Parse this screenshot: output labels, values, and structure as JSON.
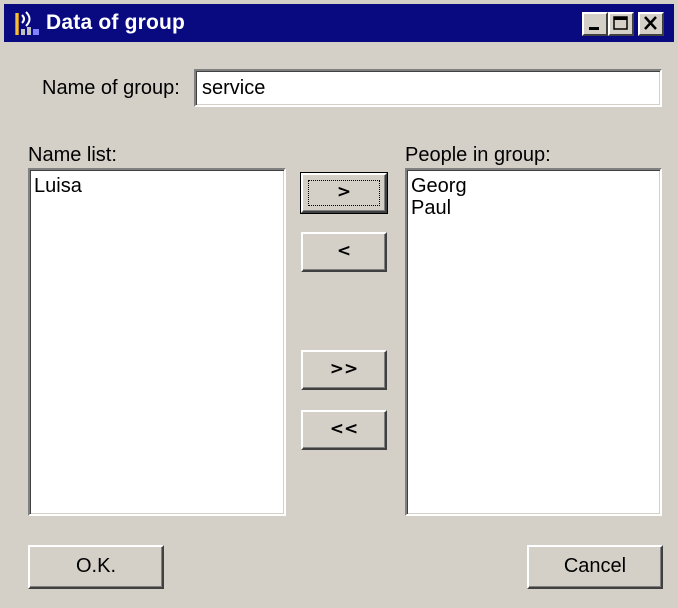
{
  "window": {
    "title": "Data of group",
    "icon": "antenna-app-icon"
  },
  "form": {
    "group_name_label": "Name of group:",
    "group_name_value": "service"
  },
  "name_list": {
    "label": "Name list:",
    "items": [
      "Luisa"
    ]
  },
  "group_list": {
    "label": "People in group:",
    "items": [
      "Georg",
      "Paul"
    ]
  },
  "transfer_buttons": {
    "add_one": ">",
    "remove_one": "<",
    "add_all": ">>",
    "remove_all": "<<"
  },
  "actions": {
    "ok": "O.K.",
    "cancel": "Cancel"
  },
  "colors": {
    "titlebar": "#0a0a80",
    "face": "#d4d0c8"
  }
}
